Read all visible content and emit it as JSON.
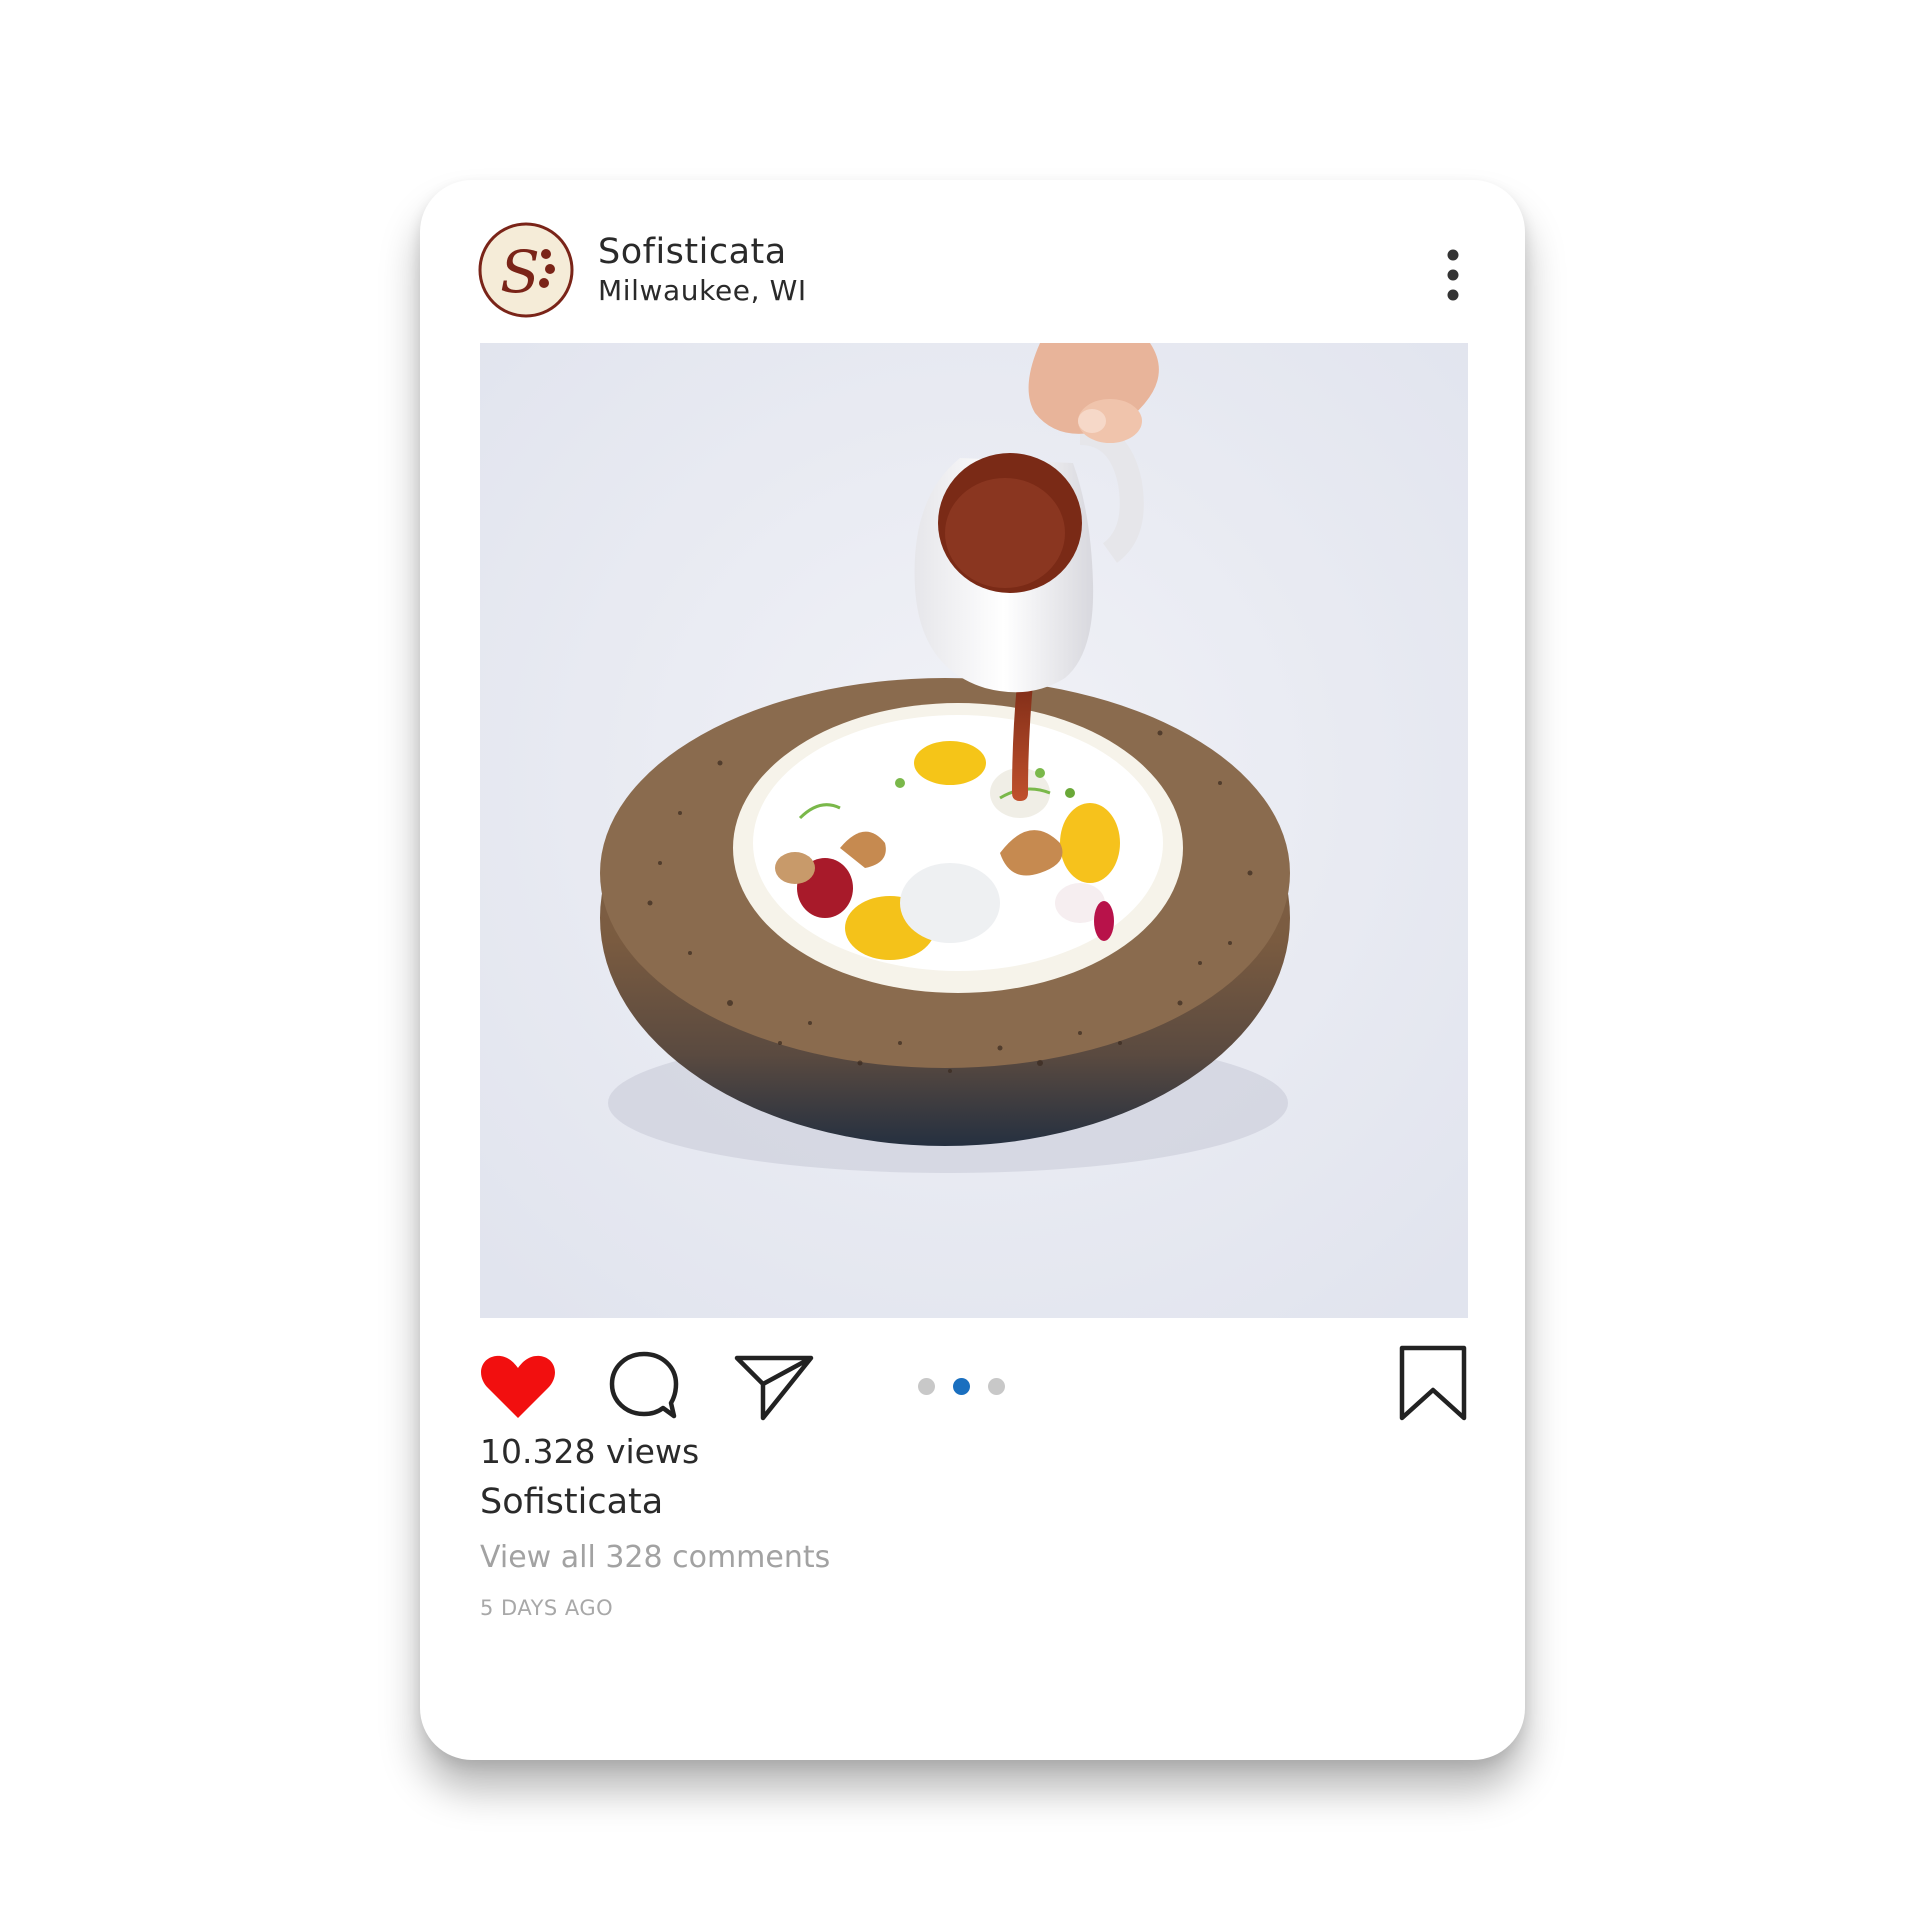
{
  "post": {
    "account_name": "Sofisticata",
    "location": "Milwaukee, WI",
    "avatar_monogram": "S",
    "views": "10.328 views",
    "caption_user": "Sofisticata",
    "comments_link": "View all 328 comments",
    "timestamp": "5 DAYS AGO",
    "carousel": {
      "count": 3,
      "active_index": 1
    }
  },
  "icons": {
    "more": "more-vertical-icon",
    "like": "heart-icon",
    "comment": "comment-bubble-icon",
    "share": "paper-plane-icon",
    "save": "bookmark-icon"
  },
  "colors": {
    "like_active": "#f20f0f",
    "carousel_active": "#1a6fbf",
    "carousel_inactive": "#c8c8c8",
    "brand_maroon": "#7a2418",
    "brand_cream": "#f5ecd8",
    "text_primary": "#2a2a2a",
    "text_secondary": "#a2a2a2"
  }
}
